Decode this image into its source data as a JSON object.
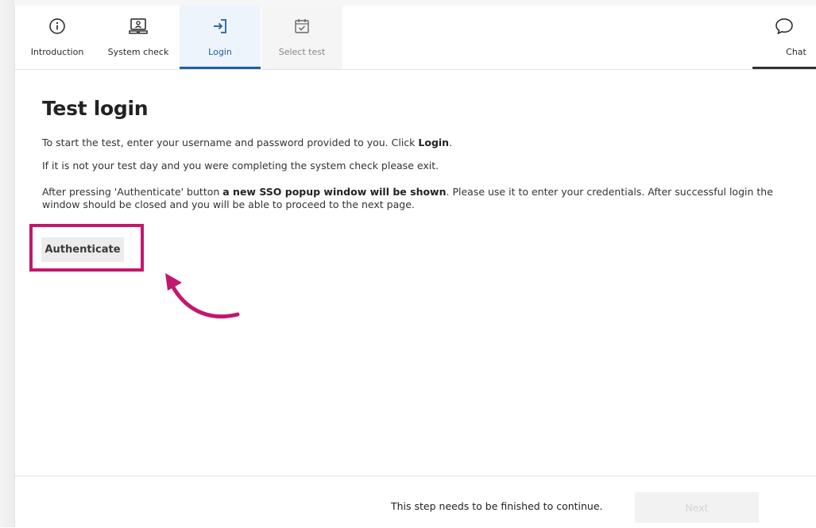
{
  "nav": {
    "tabs": [
      {
        "label": "Introduction",
        "icon": "info-icon",
        "state": "default"
      },
      {
        "label": "System check",
        "icon": "laptop-user-icon",
        "state": "default"
      },
      {
        "label": "Login",
        "icon": "login-icon",
        "state": "active"
      },
      {
        "label": "Select test",
        "icon": "calendar-check-icon",
        "state": "disabled"
      }
    ],
    "chat": {
      "label": "Chat",
      "icon": "chat-bubble-icon"
    }
  },
  "main": {
    "title": "Test login",
    "p1_text": "To start the test, enter your username and password provided to you. Click ",
    "p1_bold": "Login",
    "p1_end": ".",
    "p2": "If it is not your test day and you were completing the system check please exit.",
    "p3_start": "After pressing 'Authenticate' button ",
    "p3_bold": "a new SSO popup window will be shown",
    "p3_end": ". Please use it to enter your credentials. After successful login the window should be closed and you will be able to proceed to the next page.",
    "authenticate_label": "Authenticate"
  },
  "footer": {
    "message": "This step needs to be finished to continue.",
    "next_label": "Next"
  },
  "colors": {
    "accent": "#1f5ea8",
    "highlight": "#c2186d"
  }
}
